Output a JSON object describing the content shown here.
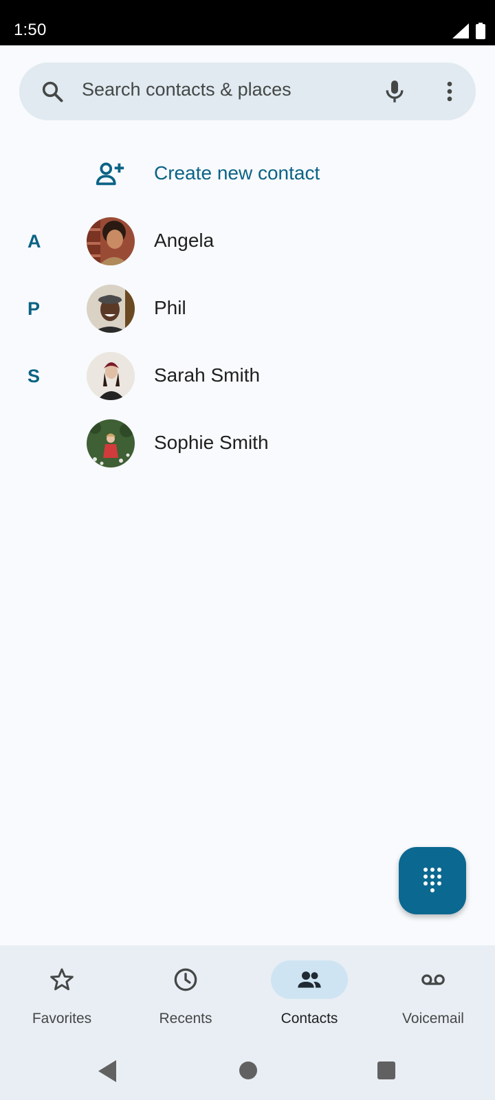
{
  "status_bar": {
    "time": "1:50"
  },
  "search": {
    "placeholder": "Search contacts & places"
  },
  "create_contact": {
    "label": "Create new contact"
  },
  "contacts": [
    {
      "letter": "A",
      "name": "Angela"
    },
    {
      "letter": "P",
      "name": "Phil"
    },
    {
      "letter": "S",
      "name": "Sarah Smith"
    },
    {
      "letter": "",
      "name": "Sophie Smith"
    }
  ],
  "bottom_nav": {
    "items": [
      {
        "label": "Favorites",
        "icon": "star-icon",
        "active": false
      },
      {
        "label": "Recents",
        "icon": "clock-icon",
        "active": false
      },
      {
        "label": "Contacts",
        "icon": "people-icon",
        "active": true
      },
      {
        "label": "Voicemail",
        "icon": "voicemail-icon",
        "active": false
      }
    ]
  },
  "colors": {
    "accent": "#0b6385",
    "fab": "#0b6890",
    "background": "#f8fafd",
    "search_bg": "#e0eaf0",
    "nav_bg": "#e8eef4",
    "active_pill": "#cfe4f3"
  }
}
